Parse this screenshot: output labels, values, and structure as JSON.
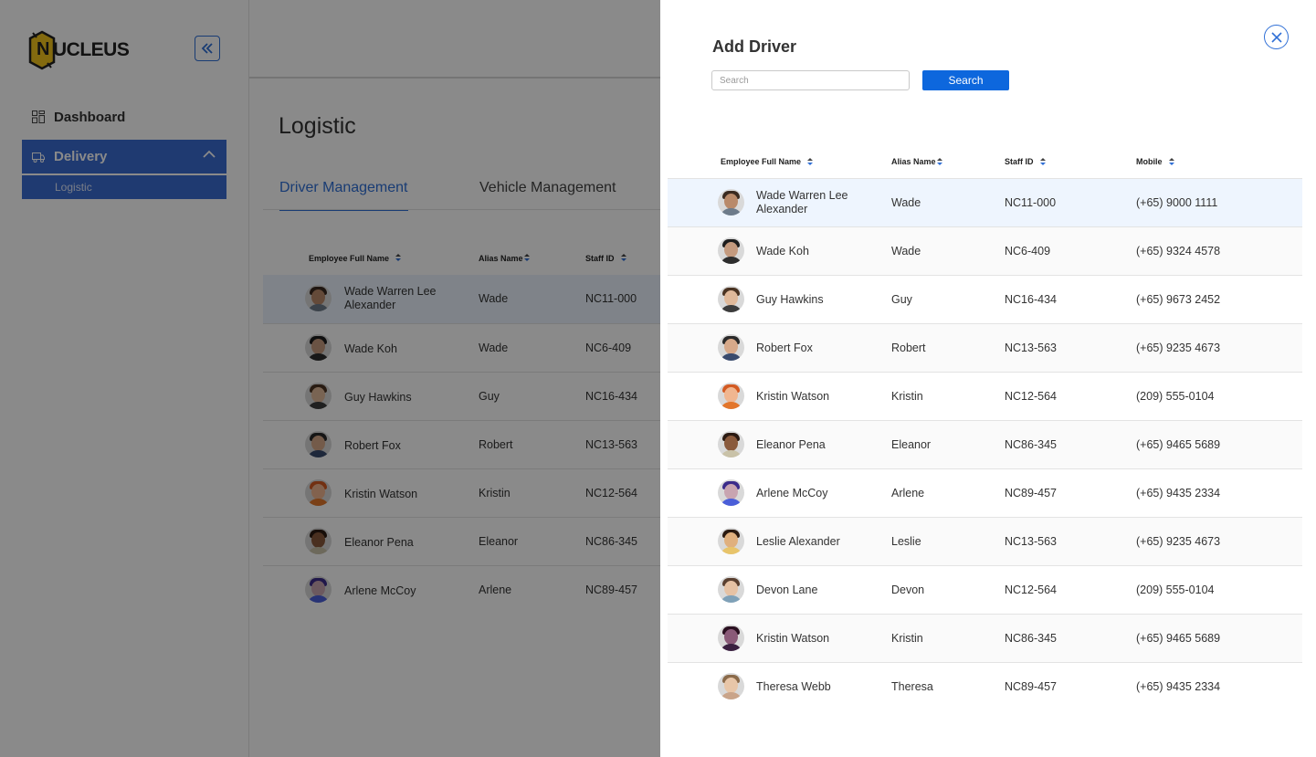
{
  "app": {
    "brand": "NUCLEUS",
    "brand_letter": "N",
    "sidebar": {
      "items": [
        {
          "label": "Dashboard",
          "icon": "grid-icon"
        },
        {
          "label": "Delivery",
          "icon": "truck-icon",
          "expanded": true,
          "sub": [
            {
              "label": "Logistic"
            }
          ]
        }
      ]
    },
    "page_title": "Logistic",
    "tabs": [
      {
        "label": "Driver Management",
        "active": true
      },
      {
        "label": "Vehicle Management",
        "active": false
      }
    ],
    "table": {
      "columns": [
        "Employee Full Name",
        "Alias Name",
        "Staff ID"
      ],
      "rows": [
        {
          "name": "Wade Warren Lee Alexander",
          "alias": "Wade",
          "staff_id": "NC11-000"
        },
        {
          "name": "Wade Koh",
          "alias": "Wade",
          "staff_id": "NC6-409"
        },
        {
          "name": "Guy Hawkins",
          "alias": "Guy",
          "staff_id": "NC16-434"
        },
        {
          "name": "Robert Fox",
          "alias": "Robert",
          "staff_id": "NC13-563"
        },
        {
          "name": "Kristin Watson",
          "alias": "Kristin",
          "staff_id": "NC12-564"
        },
        {
          "name": "Eleanor Pena",
          "alias": "Eleanor",
          "staff_id": "NC86-345"
        },
        {
          "name": "Arlene McCoy",
          "alias": "Arlene",
          "staff_id": "NC89-457"
        }
      ]
    }
  },
  "modal": {
    "title": "Add Driver",
    "search": {
      "placeholder": "Search",
      "value": "",
      "button_label": "Search"
    },
    "columns": [
      "Employee Full Name",
      "Alias Name",
      "Staff ID",
      "Mobile"
    ],
    "rows": [
      {
        "name": "Wade Warren Lee Alexander",
        "name_line1": "Wade Warren Lee",
        "name_line2": "Alexander",
        "alias": "Wade",
        "staff_id": "NC11-000",
        "mobile": "(+65) 9000 1111",
        "highlighted": true
      },
      {
        "name": "Wade Koh",
        "alias": "Wade",
        "staff_id": "NC6-409",
        "mobile": "(+65) 9324 4578"
      },
      {
        "name": "Guy Hawkins",
        "alias": "Guy",
        "staff_id": "NC16-434",
        "mobile": "(+65) 9673 2452"
      },
      {
        "name": "Robert Fox",
        "alias": "Robert",
        "staff_id": "NC13-563",
        "mobile": "(+65) 9235 4673"
      },
      {
        "name": "Kristin Watson",
        "alias": "Kristin",
        "staff_id": "NC12-564",
        "mobile": "(209) 555-0104"
      },
      {
        "name": "Eleanor Pena",
        "alias": "Eleanor",
        "staff_id": "NC86-345",
        "mobile": "(+65) 9465 5689"
      },
      {
        "name": "Arlene McCoy",
        "alias": "Arlene",
        "staff_id": "NC89-457",
        "mobile": "(+65) 9435 2334"
      },
      {
        "name": "Leslie Alexander",
        "alias": "Leslie",
        "staff_id": "NC13-563",
        "mobile": "(+65) 9235 4673"
      },
      {
        "name": "Devon Lane",
        "alias": "Devon",
        "staff_id": "NC12-564",
        "mobile": "(209) 555-0104"
      },
      {
        "name": "Kristin Watson",
        "alias": "Kristin",
        "staff_id": "NC86-345",
        "mobile": "(+65) 9465 5689"
      },
      {
        "name": "Theresa Webb",
        "alias": "Theresa",
        "staff_id": "NC89-457",
        "mobile": "(+65) 9435 2334"
      }
    ]
  },
  "colors": {
    "accent": "#2f6fd6",
    "button": "#0d67dd",
    "row_highlight": "#eef5fe",
    "overlay": "#000000"
  }
}
